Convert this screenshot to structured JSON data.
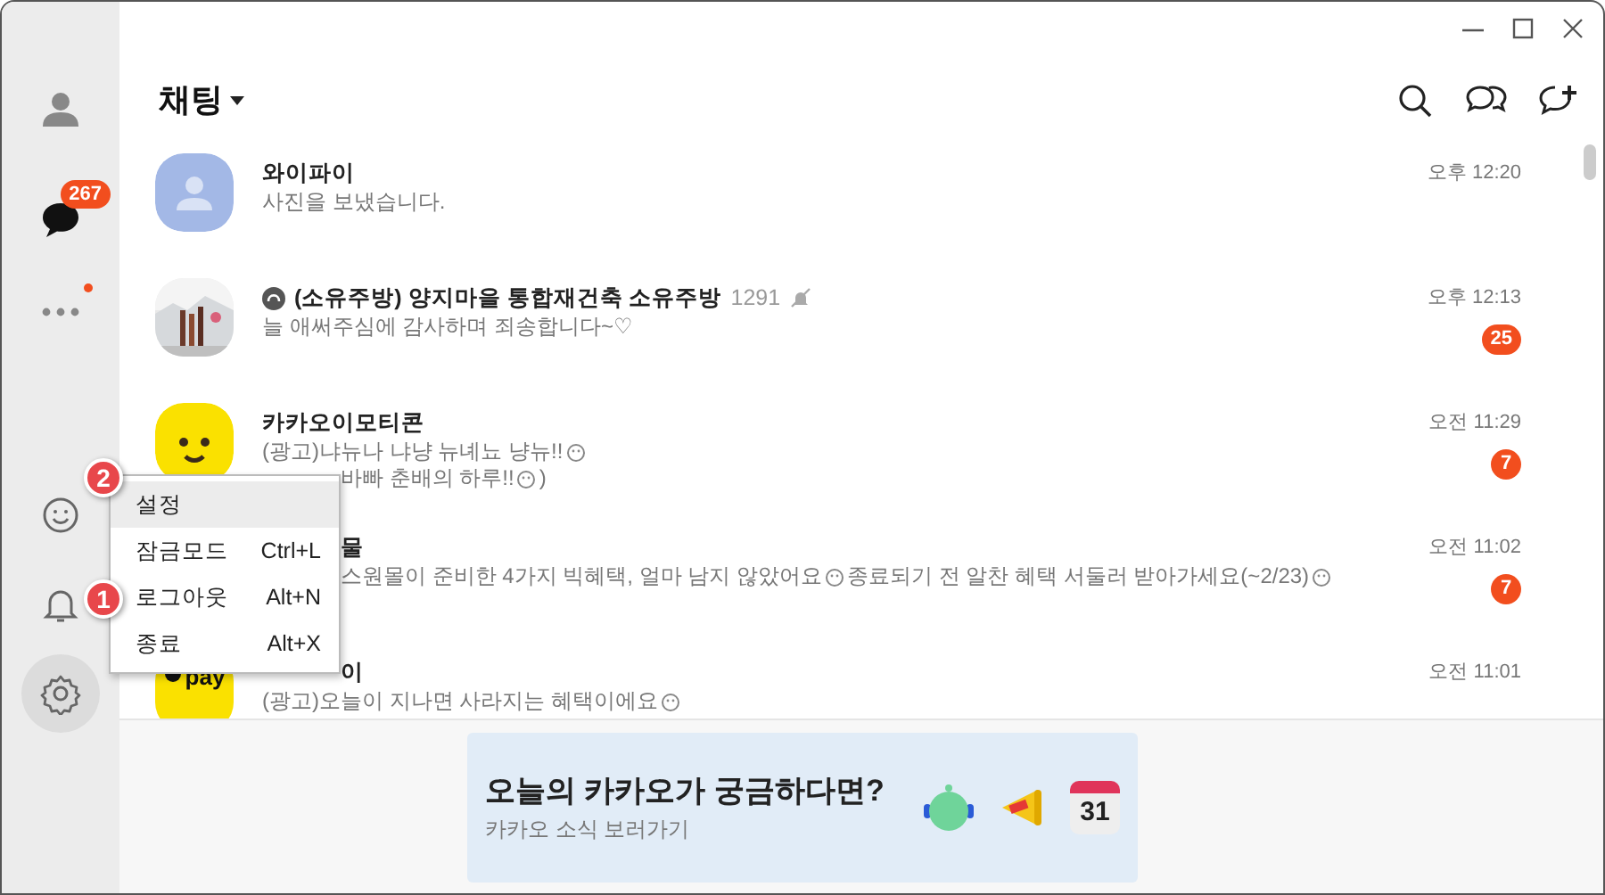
{
  "sidebar": {
    "items": [
      {
        "kind": "profile",
        "selected": false
      },
      {
        "kind": "chats",
        "selected": true,
        "badge": "267"
      },
      {
        "kind": "more",
        "selected": false,
        "dot": true
      },
      {
        "kind": "emoticon",
        "selected": false
      },
      {
        "kind": "bell",
        "selected": false
      },
      {
        "kind": "settings",
        "selected": true
      }
    ]
  },
  "header": {
    "title": "채팅"
  },
  "chats": [
    {
      "avatar": {
        "kind": "person"
      },
      "title": [
        {
          "text": "와이파이"
        }
      ],
      "message": [
        [
          {
            "text": "사진을 보냈습니다."
          }
        ]
      ],
      "time": "오후 12:20"
    },
    {
      "avatar": {
        "kind": "picture"
      },
      "title": [
        {
          "kind": "openchat"
        },
        {
          "text": "(소유주방)  양지마을 통합재건축 소유주방"
        },
        {
          "text": "1291",
          "kind": "count"
        },
        {
          "kind": "muted"
        }
      ],
      "message": [
        [
          {
            "text": "늘 애써주심에 감사하며 죄송합니다~♡"
          }
        ]
      ],
      "time": "오후 12:13",
      "unread": "25"
    },
    {
      "avatar": {
        "kind": "emoticon"
      },
      "title": [
        {
          "text": "카카오이모티콘"
        }
      ],
      "message": [
        [
          {
            "text": "(광고)냐뉴나 냐냥 뉴녜뇨 냥뉴!!"
          },
          {
            "kind": "emoji"
          }
        ],
        [
          {
            "text": "바빠 춘배의 하루!!",
            "partial": true
          },
          {
            "kind": "emoji"
          },
          {
            "text": ")"
          }
        ]
      ],
      "time": "오전 11:29",
      "unread": "7"
    },
    {
      "title": [
        {
          "text": "물",
          "partial": true
        }
      ],
      "message": [
        [
          {
            "text": "스원몰이 준비한 4가지 빅혜택, 얼마 남지 않았어요",
            "partial": true
          },
          {
            "kind": "emoji"
          },
          {
            "text": "종료되기 전 알찬 혜택 서둘러 받아가세요(~2/23)"
          },
          {
            "kind": "emoji"
          }
        ]
      ],
      "time": "오전 11:02",
      "unread": "7"
    },
    {
      "avatar": {
        "kind": "pay",
        "text": "pay"
      },
      "title": [
        {
          "text": "이",
          "partial": true
        }
      ],
      "message": [
        [
          {
            "text": "(광고)오늘이 지나면 사라지는 혜택이에요"
          },
          {
            "kind": "emoji"
          }
        ]
      ],
      "time": "오전 11:01"
    }
  ],
  "menu": {
    "items": [
      {
        "label": "설정",
        "selected": true
      },
      {
        "label": "잠금모드",
        "shortcut": "Ctrl+L",
        "selected": false
      },
      {
        "label": "로그아웃",
        "shortcut": "Alt+N",
        "selected": false
      },
      {
        "label": "종료",
        "shortcut": "Alt+X",
        "selected": false
      }
    ]
  },
  "callouts": [
    {
      "number": "2"
    },
    {
      "number": "1"
    }
  ],
  "banner": {
    "title": "오늘의 카카오가 궁금하다면?",
    "subtitle": "카카오 소식 보러가기",
    "calendar_day": "31"
  }
}
